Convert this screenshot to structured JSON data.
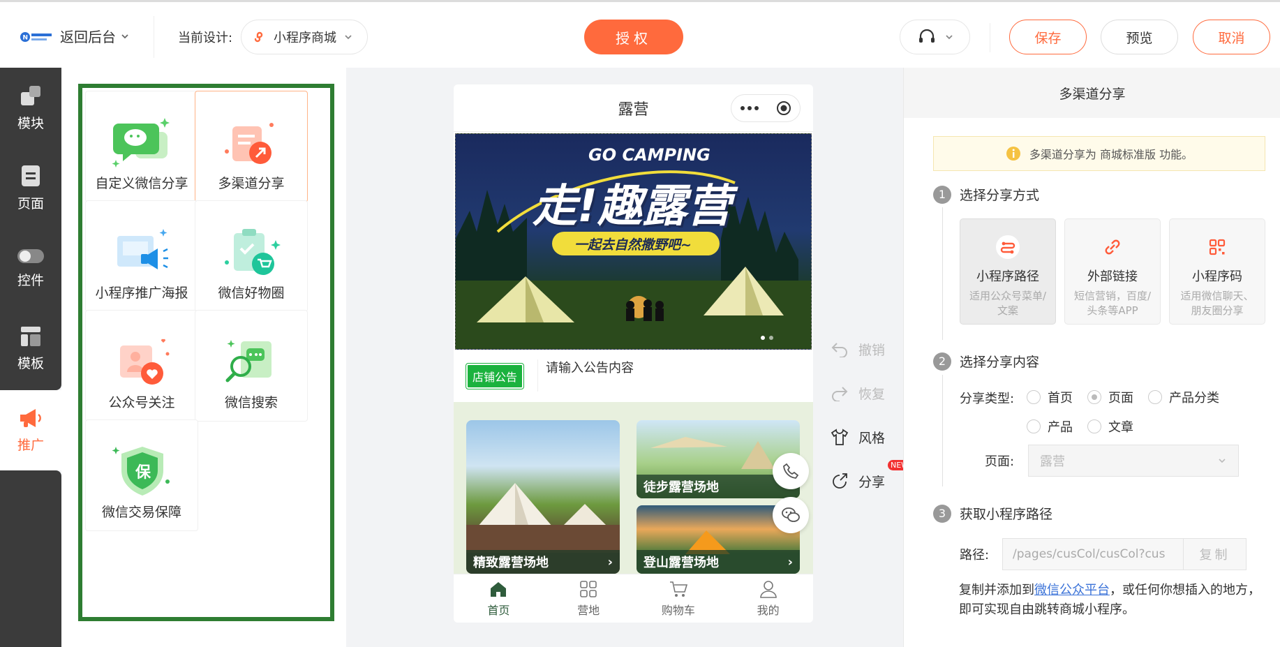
{
  "header": {
    "back_label": "返回后台",
    "current_design_label": "当前设计:",
    "design_name": "小程序商城",
    "auth_label": "授权",
    "save_label": "保存",
    "preview_label": "预览",
    "cancel_label": "取消"
  },
  "leftnav": {
    "items": [
      {
        "label": "模块",
        "icon": "module-icon"
      },
      {
        "label": "页面",
        "icon": "page-icon"
      },
      {
        "label": "控件",
        "icon": "toggle-icon"
      },
      {
        "label": "模板",
        "icon": "template-icon"
      },
      {
        "label": "推广",
        "icon": "megaphone-icon"
      }
    ],
    "active": "推广"
  },
  "promo": {
    "cards": [
      {
        "label": "自定义微信分享"
      },
      {
        "label": "多渠道分享"
      },
      {
        "label": "小程序推广海报"
      },
      {
        "label": "微信好物圈"
      },
      {
        "label": "公众号关注"
      },
      {
        "label": "微信搜索"
      },
      {
        "label": "微信交易保障"
      }
    ],
    "selected": "多渠道分享",
    "shield_char": "保"
  },
  "phone": {
    "title": "露营",
    "banner_en": "GO CAMPING",
    "banner_big": "走!趣露营",
    "banner_sub": "一起去自然撒野吧~",
    "notice_tag": "店铺公告",
    "notice_text": "请输入公告内容",
    "tiles": [
      {
        "label": "精致露营场地"
      },
      {
        "label": "徒步露营场地"
      },
      {
        "label": "登山露营场地"
      }
    ],
    "tabs": [
      {
        "label": "首页"
      },
      {
        "label": "营地"
      },
      {
        "label": "购物车"
      },
      {
        "label": "我的"
      }
    ]
  },
  "tools": {
    "undo": "撤销",
    "redo": "恢复",
    "style": "风格",
    "share": "分享",
    "badge": "NEW"
  },
  "right": {
    "title": "多渠道分享",
    "tip": "多渠道分享为 商城标准版 功能。",
    "step1": "选择分享方式",
    "modes": [
      {
        "title": "小程序路径",
        "desc": "适用公众号菜单/文案"
      },
      {
        "title": "外部链接",
        "desc": "短信营销，百度/头条等APP"
      },
      {
        "title": "小程序码",
        "desc": "适用微信聊天、朋友圈分享"
      }
    ],
    "step2": "选择分享内容",
    "share_type_label": "分享类型:",
    "types": [
      "首页",
      "页面",
      "产品分类",
      "产品",
      "文章"
    ],
    "selected_type": "页面",
    "page_label": "页面:",
    "page_value": "露营",
    "step3": "获取小程序路径",
    "path_label": "路径:",
    "path_value": "/pages/cusCol/cusCol?cus",
    "copy_label": "复制",
    "desc_pre": "复制并添加到",
    "desc_link": "微信公众平台",
    "desc_post": "，或任何你想插入的地方，即可实现自由跳转商城小程序。"
  }
}
